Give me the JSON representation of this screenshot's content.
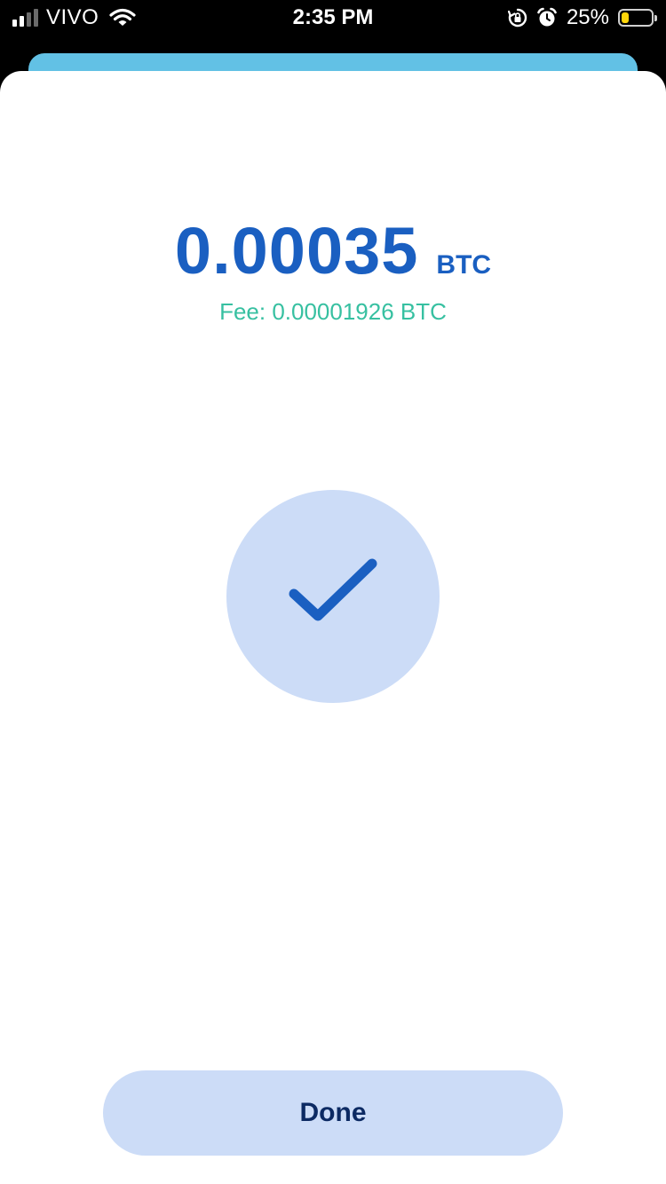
{
  "status_bar": {
    "carrier": "VIVO",
    "time": "2:35 PM",
    "battery_percent": "25%",
    "battery_level": 0.25,
    "icons": [
      "signal-icon",
      "wifi-icon",
      "rotation-lock-icon",
      "alarm-icon",
      "battery-icon"
    ]
  },
  "transaction": {
    "amount": "0.00035",
    "unit": "BTC",
    "fee": "Fee: 0.00001926 BTC"
  },
  "success_icon": "checkmark-icon",
  "actions": {
    "done_label": "Done"
  },
  "colors": {
    "amount": "#1a5fc1",
    "fee": "#37c0a1",
    "button_bg": "#ccdcf7",
    "button_text": "#0c2a63",
    "back_sheet": "#62c1e5"
  }
}
